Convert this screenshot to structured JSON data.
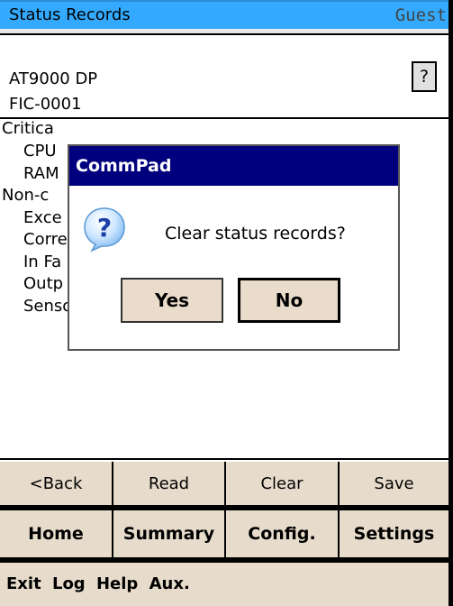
{
  "header": {
    "title": "Status Records",
    "user": "Guest"
  },
  "device": {
    "model": "AT9000 DP",
    "tag": "FIC-0001",
    "help_label": "?"
  },
  "records": [
    {
      "text": "Critica",
      "indent": 0
    },
    {
      "text": "CPU",
      "indent": 1
    },
    {
      "text": "RAM",
      "indent": 1
    },
    {
      "text": "Non-c",
      "indent": 0
    },
    {
      "text": "Exce",
      "indent": 1
    },
    {
      "text": "Corre",
      "indent": 1
    },
    {
      "text": "In Fa",
      "indent": 1
    },
    {
      "text": "Outp",
      "indent": 1
    },
    {
      "text": "Sensor Temp. Alarm Detected",
      "indent": 1
    }
  ],
  "dialog": {
    "title": "CommPad",
    "message": "Clear status records?",
    "yes_label": "Yes",
    "no_label": "No",
    "icon": "question-icon"
  },
  "actions": {
    "back": "<Back",
    "read": "Read",
    "clear": "Clear",
    "save": "Save"
  },
  "nav": {
    "home": "Home",
    "summary": "Summary",
    "config": "Config.",
    "settings": "Settings"
  },
  "menu": {
    "exit": "Exit",
    "log": "Log",
    "help": "Help",
    "aux": "Aux."
  },
  "colors": {
    "titlebar": "#33aaff",
    "dialog_title": "#00007f",
    "button_bg": "#e7dccb"
  }
}
